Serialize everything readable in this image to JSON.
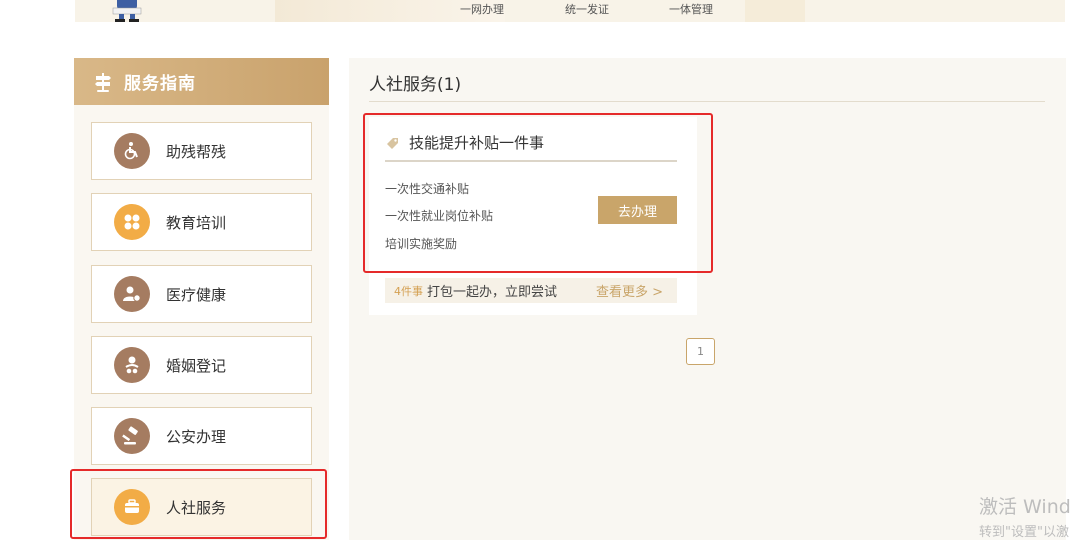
{
  "banner": {
    "items": [
      "一网办理",
      "统一发证",
      "一体管理"
    ]
  },
  "sidebar": {
    "title": "服务指南",
    "items": [
      {
        "label": "助残帮残",
        "icon": "wheelchair-icon"
      },
      {
        "label": "教育培训",
        "icon": "grid-icon"
      },
      {
        "label": "医疗健康",
        "icon": "person-medical-icon"
      },
      {
        "label": "婚姻登记",
        "icon": "couple-icon"
      },
      {
        "label": "公安办理",
        "icon": "gavel-icon"
      },
      {
        "label": "人社服务",
        "icon": "briefcase-icon"
      }
    ],
    "active_index": 5
  },
  "main": {
    "title": "人社服务(1)",
    "card": {
      "title": "技能提升补贴一件事",
      "items": [
        "一次性交通补贴",
        "一次性就业岗位补贴",
        "培训实施奖励"
      ],
      "action_label": "去办理",
      "footer_count": "4件事",
      "footer_text": "打包一起办，立即尝试",
      "more_label": "查看更多 >"
    },
    "pagination": {
      "current": "1"
    }
  },
  "watermark": {
    "line1": "激活 Wind",
    "line2": "转到\"设置\"以激"
  },
  "colors": {
    "accent": "#c9a56a",
    "highlight_box": "#e52a2a",
    "icon_brown": "#a57c61",
    "icon_orange": "#f2ac46"
  }
}
